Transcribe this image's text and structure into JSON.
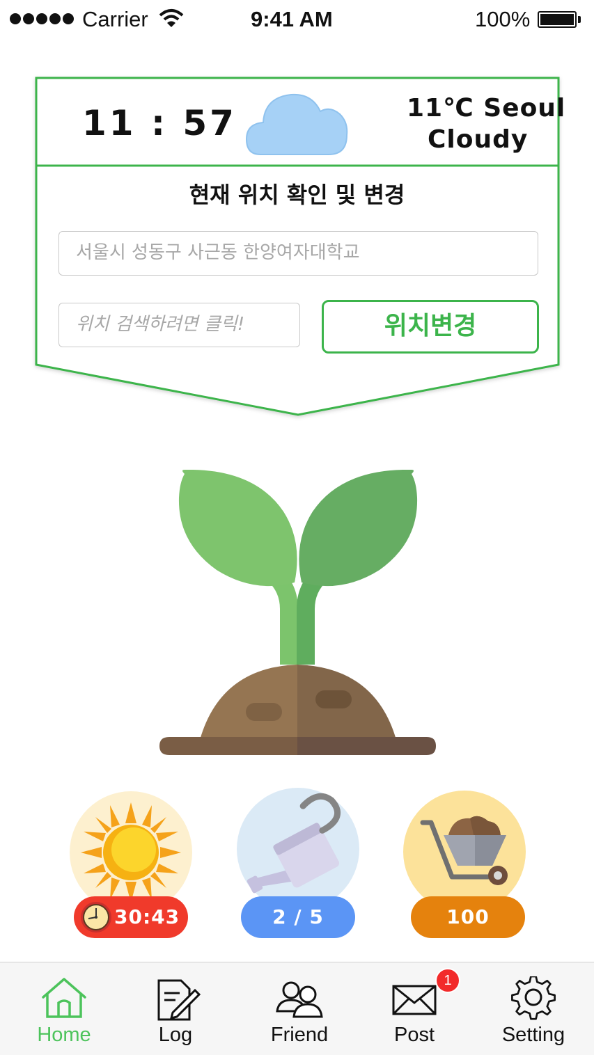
{
  "status_bar": {
    "carrier": "Carrier",
    "time": "9:41 AM",
    "battery": "100%"
  },
  "weather": {
    "time": "11 : 57",
    "temperature_city": "11℃ Seoul",
    "condition": "Cloudy",
    "section_title": "현재 위치 확인 및 변경",
    "current_address": "서울시 성동구 사근동 한양여자대학교",
    "search_placeholder": "위치 검색하려면 클릭!",
    "change_button": "위치변경"
  },
  "actions": {
    "sunlight_timer": "30:43",
    "water_count": "2 / 5",
    "soil_amount": "100"
  },
  "tabbar": {
    "home": "Home",
    "log": "Log",
    "friend": "Friend",
    "post": "Post",
    "post_badge": "1",
    "setting": "Setting"
  },
  "colors": {
    "accent_green": "#3cb44b",
    "timer_red": "#f03a2b",
    "water_blue": "#5b95f5",
    "soil_orange": "#e5820d"
  }
}
